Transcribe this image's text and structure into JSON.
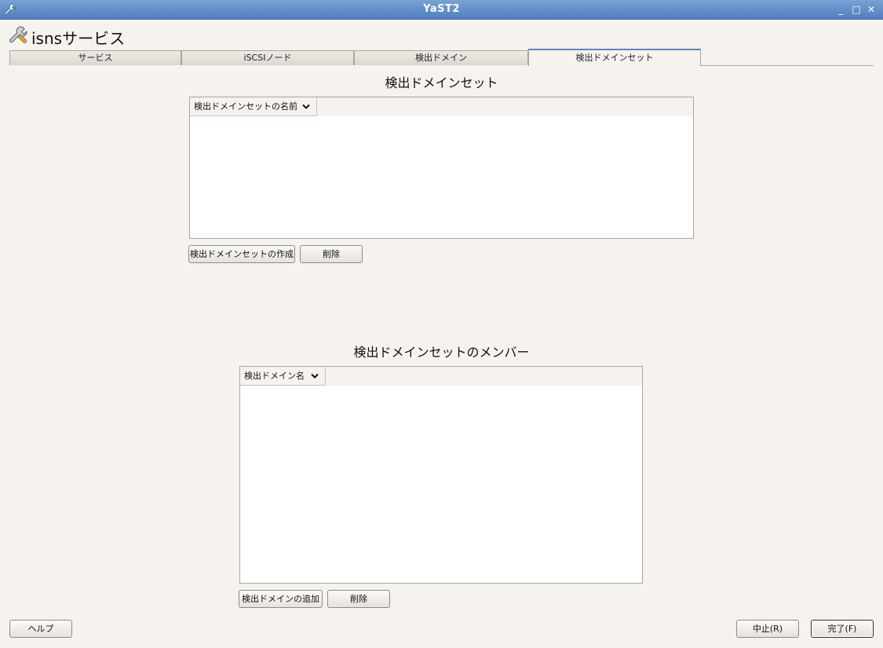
{
  "window": {
    "title": "YaST2",
    "minimize_glyph": "_",
    "maximize_glyph": "□",
    "close_glyph": "✕"
  },
  "app": {
    "title": "isnsサービス",
    "icon": "wrench-icon"
  },
  "tabs": [
    {
      "label": "サービス",
      "active": false
    },
    {
      "label": "iSCSIノード",
      "active": false
    },
    {
      "label": "検出ドメイン",
      "active": false
    },
    {
      "label": "検出ドメインセット",
      "active": true
    }
  ],
  "domain_sets": {
    "title": "検出ドメインセット",
    "column_header": "検出ドメインセットの名前",
    "rows": [],
    "create_button": "検出ドメインセットの作成",
    "delete_button": "削除"
  },
  "members": {
    "title": "検出ドメインセットのメンバー",
    "column_header": "検出ドメイン名",
    "rows": [],
    "add_button": "検出ドメインの追加",
    "delete_button": "削除"
  },
  "footer": {
    "help_button": "ヘルプ",
    "cancel_button": "中止(R)",
    "finish_button": "完了(F)"
  },
  "colors": {
    "titlebar": "#5f8cc9",
    "background": "#f6f3ee",
    "active_tab_accent": "#5a86c5"
  }
}
